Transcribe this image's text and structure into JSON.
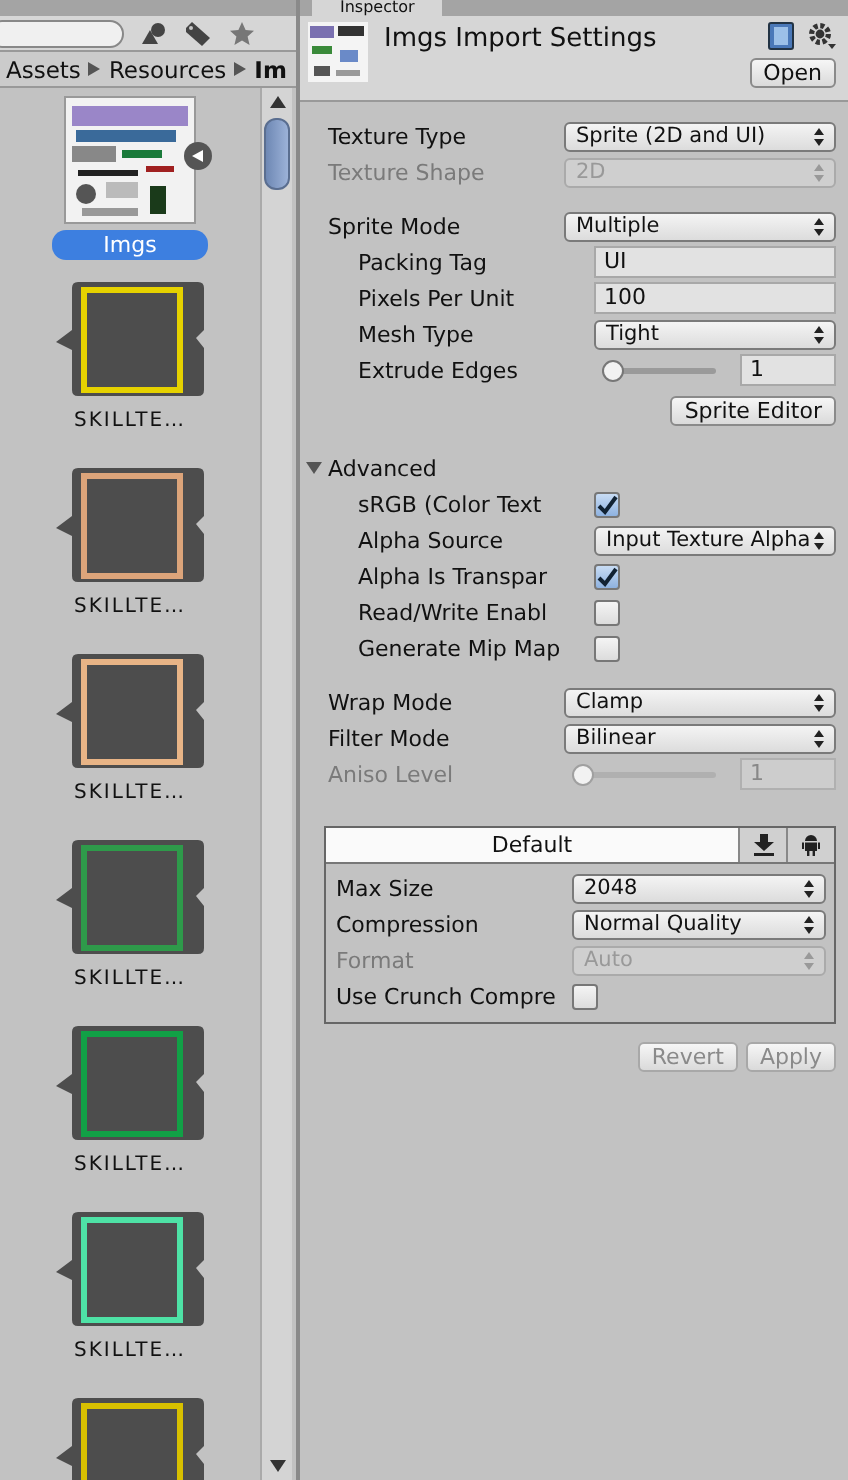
{
  "project": {
    "breadcrumb": [
      "Assets",
      "Resources",
      "Im"
    ],
    "assets": [
      {
        "kind": "atlas",
        "label": "Imgs",
        "selected": true
      },
      {
        "kind": "frame",
        "label": "SKILLTE…",
        "selected": false,
        "color": "#e6d200"
      },
      {
        "kind": "frame",
        "label": "SKILLTE…",
        "selected": false,
        "color": "#dca47a"
      },
      {
        "kind": "frame",
        "label": "SKILLTE…",
        "selected": false,
        "color": "#e8b486"
      },
      {
        "kind": "frame",
        "label": "SKILLTE…",
        "selected": false,
        "color": "#2e9a4a"
      },
      {
        "kind": "frame",
        "label": "SKILLTE…",
        "selected": false,
        "color": "#11a046"
      },
      {
        "kind": "frame",
        "label": "SKILLTE…",
        "selected": false,
        "color": "#4ee2a6"
      },
      {
        "kind": "frame",
        "selected": false,
        "color": "#d8c000"
      }
    ]
  },
  "inspector": {
    "tab": "Inspector",
    "title": "Imgs Import Settings",
    "open_button": "Open",
    "groups": [
      {
        "rows": [
          {
            "kind": "dropdown",
            "label": "Texture Type",
            "value": "Sprite (2D and UI)",
            "disabled": false
          },
          {
            "kind": "dropdown",
            "label": "Texture Shape",
            "value": "2D",
            "disabled": true
          }
        ]
      },
      {
        "rows": [
          {
            "kind": "dropdown",
            "label": "Sprite Mode",
            "value": "Multiple",
            "disabled": false,
            "children": [
              {
                "kind": "text",
                "label": "Packing Tag",
                "value": "UI",
                "disabled": false
              },
              {
                "kind": "text",
                "label": "Pixels Per Unit",
                "value": "100",
                "disabled": false
              },
              {
                "kind": "dropdown",
                "label": "Mesh Type",
                "value": "Tight",
                "disabled": false
              },
              {
                "kind": "slider",
                "label": "Extrude Edges",
                "value": "1",
                "level": 0,
                "disabled": false
              }
            ]
          },
          {
            "kind": "button",
            "label": "Sprite Editor",
            "disabled": false
          }
        ]
      },
      {
        "rows": [
          {
            "kind": "foldout",
            "label": "Advanced",
            "expanded": true,
            "children": [
              {
                "kind": "checkbox",
                "label": "sRGB (Color Text",
                "checked": true,
                "disabled": false
              },
              {
                "kind": "dropdown",
                "label": "Alpha Source",
                "value": "Input Texture Alpha",
                "disabled": false
              },
              {
                "kind": "checkbox",
                "label": "Alpha Is Transpar",
                "checked": true,
                "disabled": false
              },
              {
                "kind": "checkbox",
                "label": "Read/Write Enabl",
                "checked": false,
                "disabled": false
              },
              {
                "kind": "checkbox",
                "label": "Generate Mip Map",
                "checked": false,
                "disabled": false
              }
            ]
          }
        ]
      },
      {
        "rows": [
          {
            "kind": "dropdown",
            "label": "Wrap Mode",
            "value": "Clamp",
            "disabled": false
          },
          {
            "kind": "dropdown",
            "label": "Filter Mode",
            "value": "Bilinear",
            "disabled": false
          },
          {
            "kind": "slider",
            "label": "Aniso Level",
            "value": "1",
            "level": 0,
            "disabled": true
          }
        ]
      }
    ],
    "platform": {
      "tabs": [
        {
          "kind": "label",
          "label": "Default",
          "selected": true
        },
        {
          "kind": "download",
          "selected": false
        },
        {
          "kind": "android",
          "selected": false
        }
      ],
      "rows": [
        {
          "kind": "dropdown",
          "label": "Max Size",
          "value": "2048",
          "disabled": false
        },
        {
          "kind": "dropdown",
          "label": "Compression",
          "value": "Normal Quality",
          "disabled": false
        },
        {
          "kind": "dropdown",
          "label": "Format",
          "value": "Auto",
          "disabled": true
        },
        {
          "kind": "checkbox",
          "label": "Use Crunch Compre",
          "checked": false,
          "disabled": false
        }
      ]
    },
    "buttons": [
      {
        "label": "Revert",
        "disabled": true
      },
      {
        "label": "Apply",
        "disabled": true
      }
    ]
  }
}
